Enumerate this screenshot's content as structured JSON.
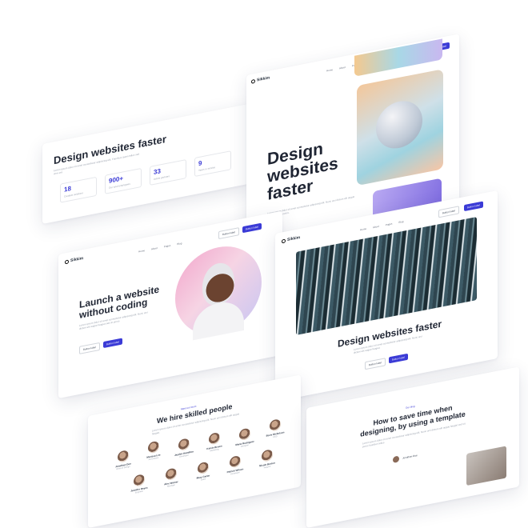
{
  "colors": {
    "accent": "#3b3bd6",
    "heading": "#1f2533",
    "muted": "#9ca3af"
  },
  "brand": {
    "logo_text": "Sikkim",
    "logo_icon": "circle-logo-icon"
  },
  "nav": {
    "items": [
      "Home",
      "About",
      "Pages",
      "Blog"
    ]
  },
  "header_buttons": {
    "secondary": "Button label",
    "primary": "Button label"
  },
  "stats_card": {
    "title": "Design websites faster",
    "lorem": "Lorem ipsum dolor sit amet consectetur adipiscing elit. Faucibus quam tellus sed urna est.",
    "stats": [
      {
        "value": "18",
        "label": "Creative solutions"
      },
      {
        "value": "900+",
        "label": "Our total employees"
      },
      {
        "value": "33",
        "label": "Active partners"
      },
      {
        "value": "9",
        "label": "Years in service"
      }
    ]
  },
  "hero_card": {
    "title_line1": "Design",
    "title_line2": "websites",
    "title_line3": "faster",
    "lorem": "Lorem ipsum dolor sit amet consectetur adipiscing elit. Nunc orci dictum elit augue feugiat sed sit purus."
  },
  "launch_card": {
    "title_line1": "Launch a website",
    "title_line2": "without coding",
    "lorem": "Lorem ipsum dolor sit amet consectetur adipiscing elit. Nunc orci dictum elit augue feugiat sed sit purus.",
    "btn_secondary": "Button label",
    "btn_primary": "Button label"
  },
  "image_card": {
    "title": "Design websites faster",
    "lorem": "Lorem ipsum dolor sit amet consectetur adipiscing elit. Nunc orci dictum elit augue feugiat.",
    "btn_secondary": "Button label",
    "btn_primary": "Button label"
  },
  "team_card": {
    "kicker": "Meet our team",
    "title": "We hire skilled people",
    "lorem": "Lorem ipsum dolor sit amet consectetur adipiscing elit. Nunc orci dictum elit augue feugiat.",
    "people": [
      {
        "name": "Jonathan Doe",
        "role": "Head of Design"
      },
      {
        "name": "Marissa Lee",
        "role": "Art Director"
      },
      {
        "name": "Jayden Hamilton",
        "role": "Developer"
      },
      {
        "name": "Kelvin Brown",
        "role": "Marketing"
      },
      {
        "name": "Maria Rodriguez",
        "role": "Designer"
      },
      {
        "name": "Boris Nickolson",
        "role": "CEO"
      },
      {
        "name": "Jennifer Reyes",
        "role": "Engineer"
      },
      {
        "name": "Alex Warner",
        "role": "Manager"
      },
      {
        "name": "Mary Carter",
        "role": "Sales"
      },
      {
        "name": "Patrick Wilson",
        "role": "Developer"
      },
      {
        "name": "Nicole Burton",
        "role": "Support"
      }
    ]
  },
  "blog_card": {
    "kicker": "Our blog",
    "title_line1": "How to save time when",
    "title_line2": "designing, by using a template",
    "lorem": "Lorem ipsum dolor sit amet consectetur adipiscing elit. Nunc orci dictum elit augue feugiat sed sit purus faucibus tellus.",
    "author": "Jonathan Doe"
  }
}
